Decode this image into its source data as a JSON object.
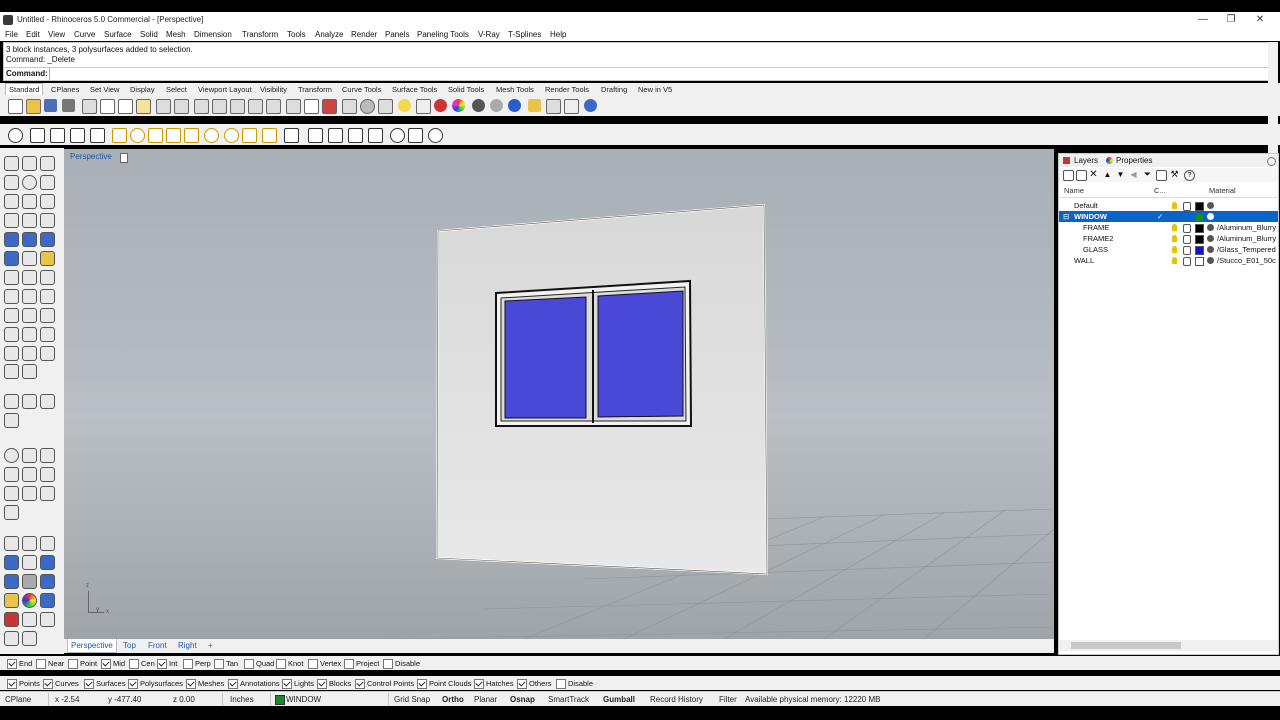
{
  "window": {
    "title": "Untitled - Rhinoceros 5.0 Commercial - [Perspective]",
    "controls": [
      "—",
      "❐",
      "✕"
    ]
  },
  "menu": [
    "File",
    "Edit",
    "View",
    "Curve",
    "Surface",
    "Solid",
    "Mesh",
    "Dimension",
    "Transform",
    "Tools",
    "Analyze",
    "Render",
    "Panels",
    "Paneling Tools",
    "V-Ray",
    "T-Splines",
    "Help"
  ],
  "history": {
    "line1": "3 block instances, 3 polysurfaces added to selection.",
    "line2": "Command: _Delete"
  },
  "command": {
    "label": "Command:",
    "value": ""
  },
  "toolbar_tabs": [
    "Standard",
    "CPlanes",
    "Set View",
    "Display",
    "Select",
    "Viewport Layout",
    "Visibility",
    "Transform",
    "Curve Tools",
    "Surface Tools",
    "Solid Tools",
    "Mesh Tools",
    "Render Tools",
    "Drafting",
    "New in V5"
  ],
  "viewport": {
    "title": "Perspective",
    "axis_x": "x",
    "axis_y": "y",
    "axis_z": "z"
  },
  "view_tabs": [
    "Perspective",
    "Top",
    "Front",
    "Right",
    "+"
  ],
  "osnaps": [
    {
      "label": "End",
      "on": true
    },
    {
      "label": "Near",
      "on": false
    },
    {
      "label": "Point",
      "on": false
    },
    {
      "label": "Mid",
      "on": true
    },
    {
      "label": "Cen",
      "on": false
    },
    {
      "label": "Int",
      "on": true
    },
    {
      "label": "Perp",
      "on": false
    },
    {
      "label": "Tan",
      "on": false
    },
    {
      "label": "Quad",
      "on": false
    },
    {
      "label": "Knot",
      "on": false
    },
    {
      "label": "Vertex",
      "on": false
    },
    {
      "label": "Project",
      "on": false
    },
    {
      "label": "Disable",
      "on": false
    }
  ],
  "filters": [
    {
      "label": "Points",
      "on": true
    },
    {
      "label": "Curves",
      "on": true
    },
    {
      "label": "Surfaces",
      "on": true
    },
    {
      "label": "Polysurfaces",
      "on": true
    },
    {
      "label": "Meshes",
      "on": true
    },
    {
      "label": "Annotations",
      "on": true
    },
    {
      "label": "Lights",
      "on": true
    },
    {
      "label": "Blocks",
      "on": true
    },
    {
      "label": "Control Points",
      "on": true
    },
    {
      "label": "Point Clouds",
      "on": true
    },
    {
      "label": "Hatches",
      "on": true
    },
    {
      "label": "Others",
      "on": true
    },
    {
      "label": "Disable",
      "on": false
    }
  ],
  "status": {
    "cplane": "CPlane",
    "x": "x -2.54",
    "y": "y -477.40",
    "z": "z 0.00",
    "units": "Inches",
    "layer": "WINDOW",
    "grid_snap": "Grid Snap",
    "ortho": "Ortho",
    "planar": "Planar",
    "osnap": "Osnap",
    "smarttrack": "SmartTrack",
    "gumball": "Gumball",
    "record_history": "Record History",
    "filter": "Filter",
    "memory": "Available physical memory: 12220 MB"
  },
  "layers_panel": {
    "tab_layers": "Layers",
    "tab_properties": "Properties",
    "col_name": "Name",
    "col_current": "C...",
    "col_material": "Material",
    "rows": [
      {
        "name": "Default",
        "material": "",
        "swatch": "#000000",
        "selected": false,
        "indent": 0
      },
      {
        "name": "WINDOW",
        "material": "",
        "swatch": "#1a8a2a",
        "selected": true,
        "indent": 0
      },
      {
        "name": "FRAME",
        "material": "/Aluminum_Blurry",
        "swatch": "#000000",
        "selected": false,
        "indent": 1
      },
      {
        "name": "FRAME2",
        "material": "/Aluminum_Blurry",
        "swatch": "#000000",
        "selected": false,
        "indent": 1
      },
      {
        "name": "GLASS",
        "material": "/Glass_Tempered",
        "swatch": "#1010e0",
        "selected": false,
        "indent": 1
      },
      {
        "name": "WALL",
        "material": "/Stucco_E01_50c",
        "swatch": "#ffffff",
        "selected": false,
        "indent": 0
      }
    ]
  },
  "colors": {
    "glass": "#4a48d6",
    "selection": "#0a64c8",
    "layer_current": "#1a8a2a"
  }
}
